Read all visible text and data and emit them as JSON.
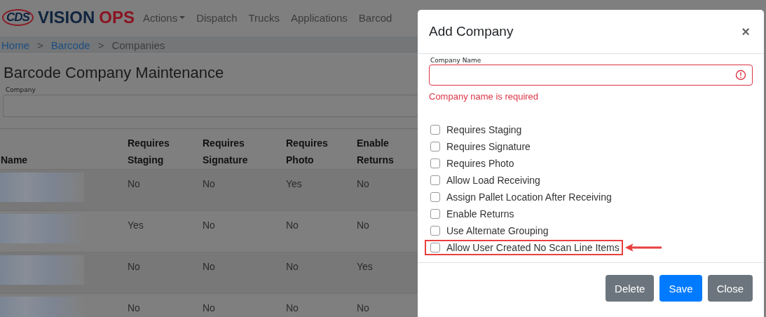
{
  "navbar": {
    "logo_mark": "CDS",
    "brand": [
      "VISION",
      "OPS"
    ],
    "items": [
      {
        "label": "Actions",
        "dropdown": true
      },
      {
        "label": "Dispatch",
        "dropdown": false
      },
      {
        "label": "Trucks",
        "dropdown": false
      },
      {
        "label": "Applications",
        "dropdown": false
      },
      {
        "label": "Barcod",
        "dropdown": false
      }
    ]
  },
  "breadcrumb": [
    {
      "label": "Home",
      "link": true
    },
    {
      "label": ">",
      "link": false
    },
    {
      "label": "Barcode",
      "link": true
    },
    {
      "label": ">",
      "link": false
    },
    {
      "label": "Companies",
      "link": false
    }
  ],
  "page": {
    "title": "Barcode Company Maintenance",
    "filter_label": "Company"
  },
  "table": {
    "columns": [
      "Name",
      [
        "Requires",
        "Staging"
      ],
      [
        "Requires",
        "Signature"
      ],
      [
        "Requires",
        "Photo"
      ],
      [
        "Enable",
        "Returns"
      ]
    ],
    "rows": [
      [
        "",
        "No",
        "No",
        "Yes",
        "No"
      ],
      [
        "",
        "Yes",
        "No",
        "No",
        "No"
      ],
      [
        "",
        "No",
        "No",
        "No",
        "Yes"
      ],
      [
        "",
        "No",
        "No",
        "No",
        "No"
      ]
    ]
  },
  "modal": {
    "title": "Add Company",
    "close": "×",
    "field_label": "Company Name",
    "field_invalid": true,
    "error": "Company name is required",
    "options": [
      {
        "label": "Requires Staging",
        "checked": false,
        "highlighted": false
      },
      {
        "label": "Requires Signature",
        "checked": false,
        "highlighted": false
      },
      {
        "label": "Requires Photo",
        "checked": false,
        "highlighted": false
      },
      {
        "label": "Allow Load Receiving",
        "checked": false,
        "highlighted": false
      },
      {
        "label": "Assign Pallet Location After Receiving",
        "checked": false,
        "highlighted": false
      },
      {
        "label": "Enable Returns",
        "checked": false,
        "highlighted": false
      },
      {
        "label": "Use Alternate Grouping",
        "checked": false,
        "highlighted": false
      },
      {
        "label": "Allow User Created No Scan Line Items",
        "checked": false,
        "highlighted": true
      }
    ],
    "buttons": [
      {
        "label": "Delete",
        "kind": "secondary"
      },
      {
        "label": "Save",
        "kind": "primary"
      },
      {
        "label": "Close",
        "kind": "secondary"
      }
    ]
  }
}
